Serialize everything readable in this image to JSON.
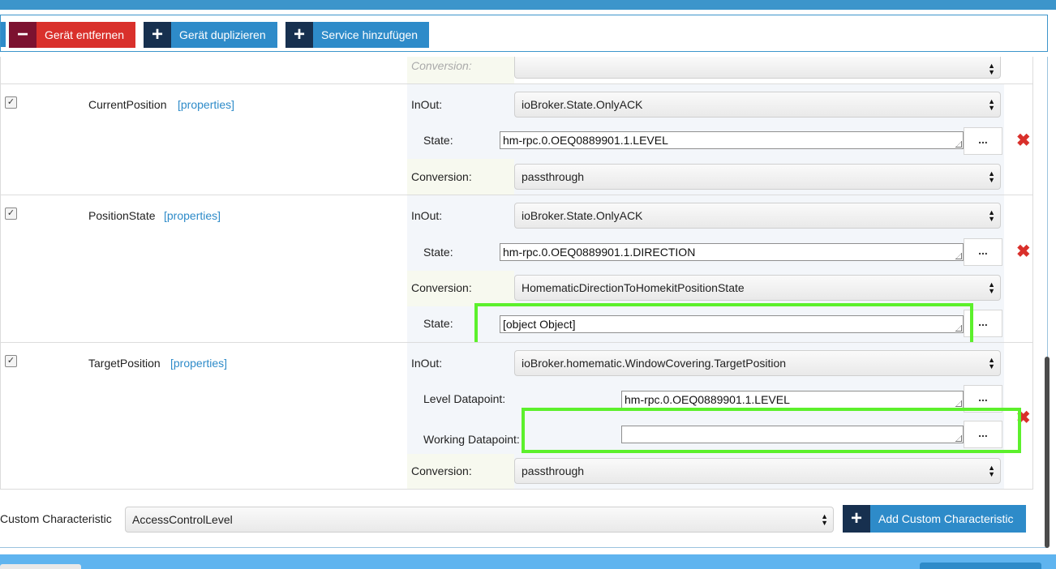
{
  "toolbar": {
    "remove_label": "Gerät entfernen",
    "duplicate_label": "Gerät duplizieren",
    "add_service_label": "Service hinzufügen",
    "minus_glyph": "−",
    "plus_glyph": "+"
  },
  "partial_row": {
    "conversion_label": "Conversion:"
  },
  "characteristics": [
    {
      "checked": "✓",
      "name": "CurrentPosition",
      "properties_label": "[properties]",
      "inout_label": "InOut:",
      "inout_value": "ioBroker.State.OnlyACK",
      "state_label": "State:",
      "state_value": "hm-rpc.0.OEQ0889901.1.LEVEL",
      "conversion_label": "Conversion:",
      "conversion_value": "passthrough"
    },
    {
      "checked": "✓",
      "name": "PositionState",
      "properties_label": "[properties]",
      "inout_label": "InOut:",
      "inout_value": "ioBroker.State.OnlyACK",
      "state_label": "State:",
      "state_value": "hm-rpc.0.OEQ0889901.1.DIRECTION",
      "conversion_label": "Conversion:",
      "conversion_value": "HomematicDirectionToHomekitPositionState",
      "conv_state_label": "State:",
      "conv_state_value": "[object Object]"
    },
    {
      "checked": "✓",
      "name": "TargetPosition",
      "properties_label": "[properties]",
      "inout_label": "InOut:",
      "inout_value": "ioBroker.homematic.WindowCovering.TargetPosition",
      "level_label": "Level Datapoint:",
      "level_value": "hm-rpc.0.OEQ0889901.1.LEVEL",
      "working_label": "Working Datapoint:",
      "working_value": "",
      "conversion_label": "Conversion:",
      "conversion_value": "passthrough"
    }
  ],
  "ellipsis": "...",
  "delete_glyph": "✖",
  "select_arrows": "▲▼",
  "custom": {
    "label": "Custom Characteristic",
    "selected": "AccessControlLevel",
    "add_label": "Add Custom Characteristic"
  },
  "colors": {
    "accent": "#2e8bc9",
    "danger": "#d9302b",
    "highlight": "#5cf02c"
  }
}
